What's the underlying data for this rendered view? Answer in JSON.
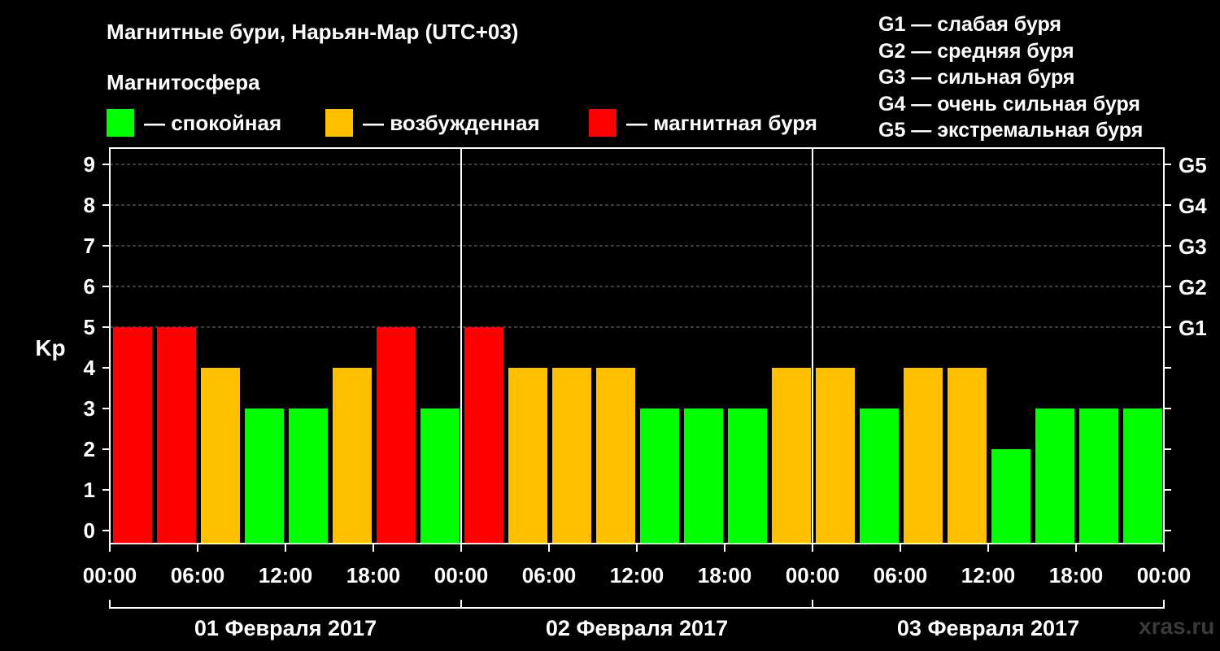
{
  "header": {
    "title": "Магнитные бури, Нарьян-Мар (UTC+03)",
    "subtitle": "Магнитосфера",
    "legend": [
      {
        "label": "— спокойная",
        "color": "#00ff00"
      },
      {
        "label": "— возбужденная",
        "color": "#ffc000"
      },
      {
        "label": "— магнитная буря",
        "color": "#ff0000"
      }
    ],
    "storm_levels": [
      "G1 — слабая буря",
      "G2 — средняя буря",
      "G3 — сильная буря",
      "G4 — очень сильная буря",
      "G5 — экстремальная буря"
    ]
  },
  "watermark": "xras.ru",
  "chart_data": {
    "type": "bar",
    "ylabel": "Kp",
    "ylim": [
      0,
      9
    ],
    "yticks": [
      0,
      1,
      2,
      3,
      4,
      5,
      6,
      7,
      8,
      9
    ],
    "right_axis_labels": [
      {
        "kp": 5,
        "label": "G1"
      },
      {
        "kp": 6,
        "label": "G2"
      },
      {
        "kp": 7,
        "label": "G3"
      },
      {
        "kp": 8,
        "label": "G4"
      },
      {
        "kp": 9,
        "label": "G5"
      }
    ],
    "x_tick_labels": [
      "00:00",
      "06:00",
      "12:00",
      "18:00",
      "00:00",
      "06:00",
      "12:00",
      "18:00",
      "00:00",
      "06:00",
      "12:00",
      "18:00",
      "00:00"
    ],
    "days": [
      "01 Февраля 2017",
      "02 Февраля 2017",
      "03 Февраля 2017"
    ],
    "interval_hours": 3,
    "values": [
      5,
      5,
      4,
      3,
      3,
      4,
      5,
      3,
      5,
      4,
      4,
      4,
      3,
      3,
      3,
      4,
      4,
      3,
      4,
      4,
      2,
      3,
      3,
      3
    ],
    "colors": {
      "quiet": "#00ff00",
      "active": "#ffc000",
      "storm": "#ff0000"
    },
    "grid": "dashed horizontal at Kp 5-9"
  }
}
